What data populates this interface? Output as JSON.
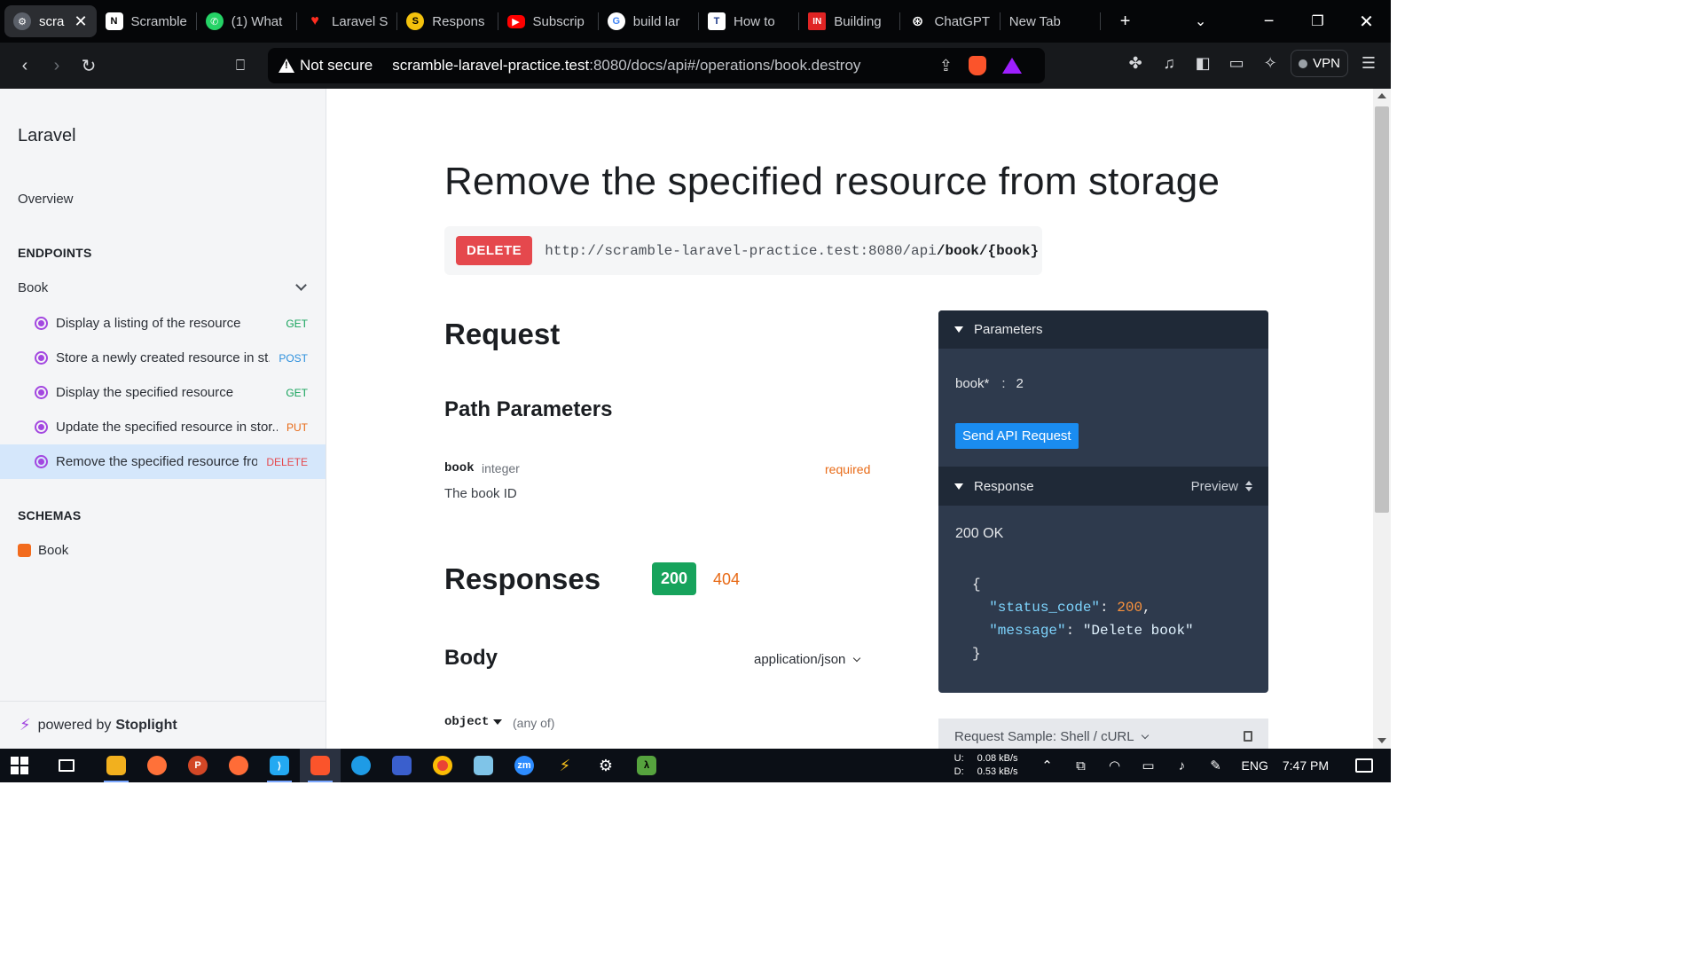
{
  "browser": {
    "tabs": [
      {
        "label": "scra",
        "color": "#3b3f46",
        "glyph": "⚙",
        "active": true
      },
      {
        "label": "Scramble",
        "color": "#ffffff",
        "glyph": "N"
      },
      {
        "label": "(1) What",
        "color": "#25d366",
        "glyph": "✆"
      },
      {
        "label": "Laravel S",
        "color": "#ff2d20",
        "glyph": "♥"
      },
      {
        "label": "Respons",
        "color": "#f4c20d",
        "glyph": "S"
      },
      {
        "label": "Subscrip",
        "color": "#ff0000",
        "glyph": "▶"
      },
      {
        "label": "build lar",
        "color": "#ffffff",
        "glyph": "G"
      },
      {
        "label": "How to",
        "color": "#1e3a8a",
        "glyph": "T"
      },
      {
        "label": "Building",
        "color": "#e02424",
        "glyph": "IN"
      },
      {
        "label": "ChatGPT",
        "color": "#111111",
        "glyph": "⊛"
      },
      {
        "label": "New Tab",
        "color": "",
        "glyph": ""
      }
    ],
    "new_tab_icon": "plus-icon",
    "not_secure_label": "Not secure",
    "url_host": "scramble-laravel-practice.test",
    "url_path": ":8080/docs/api#/operations/book.destroy",
    "vpn_label": "VPN"
  },
  "sidebar": {
    "title": "Laravel",
    "overview": "Overview",
    "endpoints_heading": "ENDPOINTS",
    "group": "Book",
    "items": [
      {
        "label": "Display a listing of the resource",
        "method": "GET"
      },
      {
        "label": "Store a newly created resource in st...",
        "method": "POST"
      },
      {
        "label": "Display the specified resource",
        "method": "GET"
      },
      {
        "label": "Update the specified resource in stor...",
        "method": "PUT"
      },
      {
        "label": "Remove the specified resource fro...",
        "method": "DELETE",
        "active": true
      }
    ],
    "schemas_heading": "SCHEMAS",
    "schema": "Book",
    "footer_prefix": "powered by",
    "footer_brand": "Stoplight"
  },
  "main": {
    "title": "Remove the specified resource from storage",
    "method": "DELETE",
    "url_base": "http://scramble-laravel-practice.test:8080/api",
    "url_path": "/book/{book}",
    "request_heading": "Request",
    "path_params_heading": "Path Parameters",
    "param": {
      "name": "book",
      "type": "integer",
      "required": "required",
      "description": "The book ID"
    },
    "responses_heading": "Responses",
    "response_codes": [
      "200",
      "404"
    ],
    "body_heading": "Body",
    "content_type": "application/json",
    "body_type": "object",
    "body_any_of": "(any of)"
  },
  "tryit": {
    "parameters_label": "Parameters",
    "param_name": "book*",
    "param_value": "2",
    "send_label": "Send API Request",
    "response_label": "Response",
    "preview_label": "Preview",
    "status": "200 OK",
    "json_open": "{",
    "json_key1": "\"status_code\"",
    "json_val1": "200",
    "json_key2": "\"message\"",
    "json_val2": "\"Delete book\"",
    "json_close": "}",
    "sample_label": "Request Sample: Shell / cURL"
  },
  "taskbar": {
    "net_up_label": "U:",
    "net_up": "0.08 kB/s",
    "net_down_label": "D:",
    "net_down": "0.53 kB/s",
    "lang": "ENG",
    "time": "7:47 PM"
  }
}
